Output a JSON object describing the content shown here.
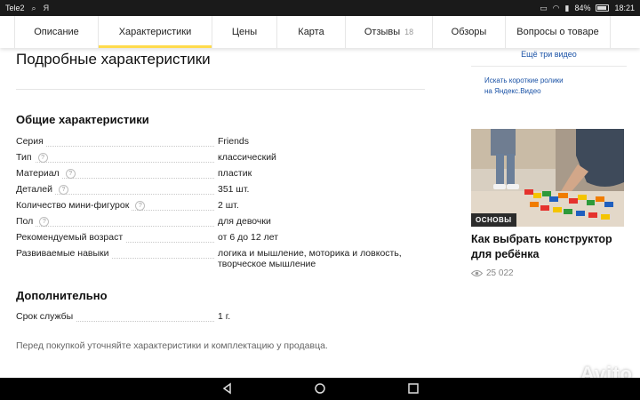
{
  "status_bar": {
    "carrier": "Tele2",
    "battery": "84%",
    "time": "18:21"
  },
  "tabs": [
    {
      "label": "Описание"
    },
    {
      "label": "Характеристики",
      "active": true
    },
    {
      "label": "Цены"
    },
    {
      "label": "Карта"
    },
    {
      "label": "Отзывы",
      "count": "18"
    },
    {
      "label": "Обзоры"
    },
    {
      "label": "Вопросы о товаре"
    }
  ],
  "page": {
    "title": "Подробные характеристики"
  },
  "sections": [
    {
      "title": "Общие характеристики",
      "rows": [
        {
          "name": "Серия",
          "value": "Friends",
          "help": false
        },
        {
          "name": "Тип",
          "value": "классический",
          "help": true
        },
        {
          "name": "Материал",
          "value": "пластик",
          "help": true
        },
        {
          "name": "Деталей",
          "value": "351 шт.",
          "help": true
        },
        {
          "name": "Количество мини-фигурок",
          "value": "2 шт.",
          "help": true
        },
        {
          "name": "Пол",
          "value": "для девочки",
          "help": true
        },
        {
          "name": "Рекомендуемый возраст",
          "value": "от 6 до 12 лет",
          "help": false
        },
        {
          "name": "Развиваемые навыки",
          "value": "логика и мышление, моторика и ловкость,",
          "value2": "творческое мышление",
          "help": false
        }
      ]
    },
    {
      "title": "Дополнительно",
      "rows": [
        {
          "name": "Срок службы",
          "value": "1 г.",
          "help": false
        }
      ]
    }
  ],
  "footnote": "Перед покупкой уточняйте характеристики и комплектацию у продавца.",
  "sidebar": {
    "video_link": "Ещё три видео",
    "short_videos_line1": "Искать короткие ролики",
    "short_videos_line2": "на Яндекс.Видео",
    "card": {
      "badge": "ОСНОВЫ",
      "title": "Как выбрать конструктор для ребёнка",
      "views": "25 022"
    }
  },
  "watermark": "Avito",
  "colors": {
    "accent": "#ffdb4d",
    "link": "#1a52a6"
  }
}
